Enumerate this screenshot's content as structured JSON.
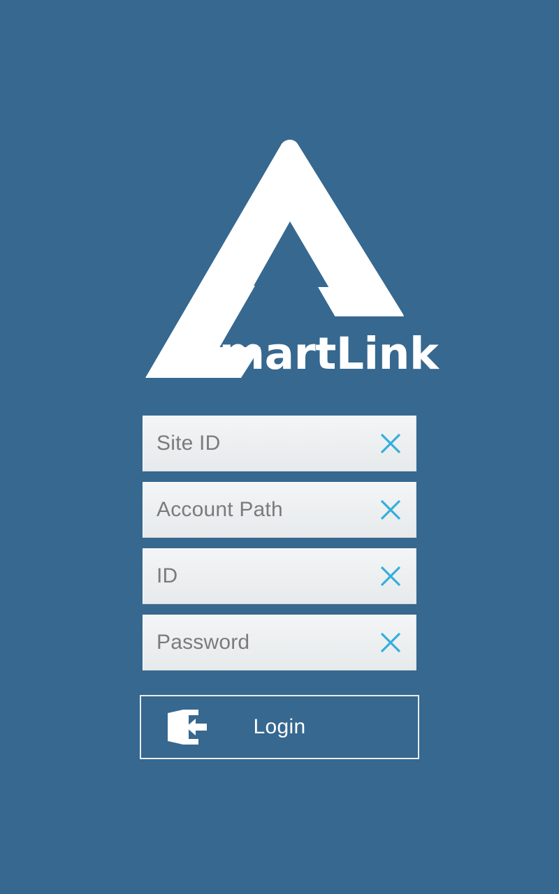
{
  "app": {
    "name": "SmartLink",
    "background_color": "#366890",
    "accent_color": "#35aedc"
  },
  "brand": {
    "wordmark": "SmartLink",
    "logo_icon": "smartlink-triangle-logo"
  },
  "form": {
    "fields": [
      {
        "name": "site-id",
        "placeholder": "Site ID",
        "value": "",
        "clear_icon": "close-x-icon"
      },
      {
        "name": "account-path",
        "placeholder": "Account Path",
        "value": "",
        "clear_icon": "close-x-icon"
      },
      {
        "name": "id",
        "placeholder": "ID",
        "value": "",
        "clear_icon": "close-x-icon"
      },
      {
        "name": "password",
        "placeholder": "Password",
        "value": "",
        "clear_icon": "close-x-icon"
      }
    ]
  },
  "login_button": {
    "label": "Login",
    "icon": "door-exit-enter-icon"
  }
}
